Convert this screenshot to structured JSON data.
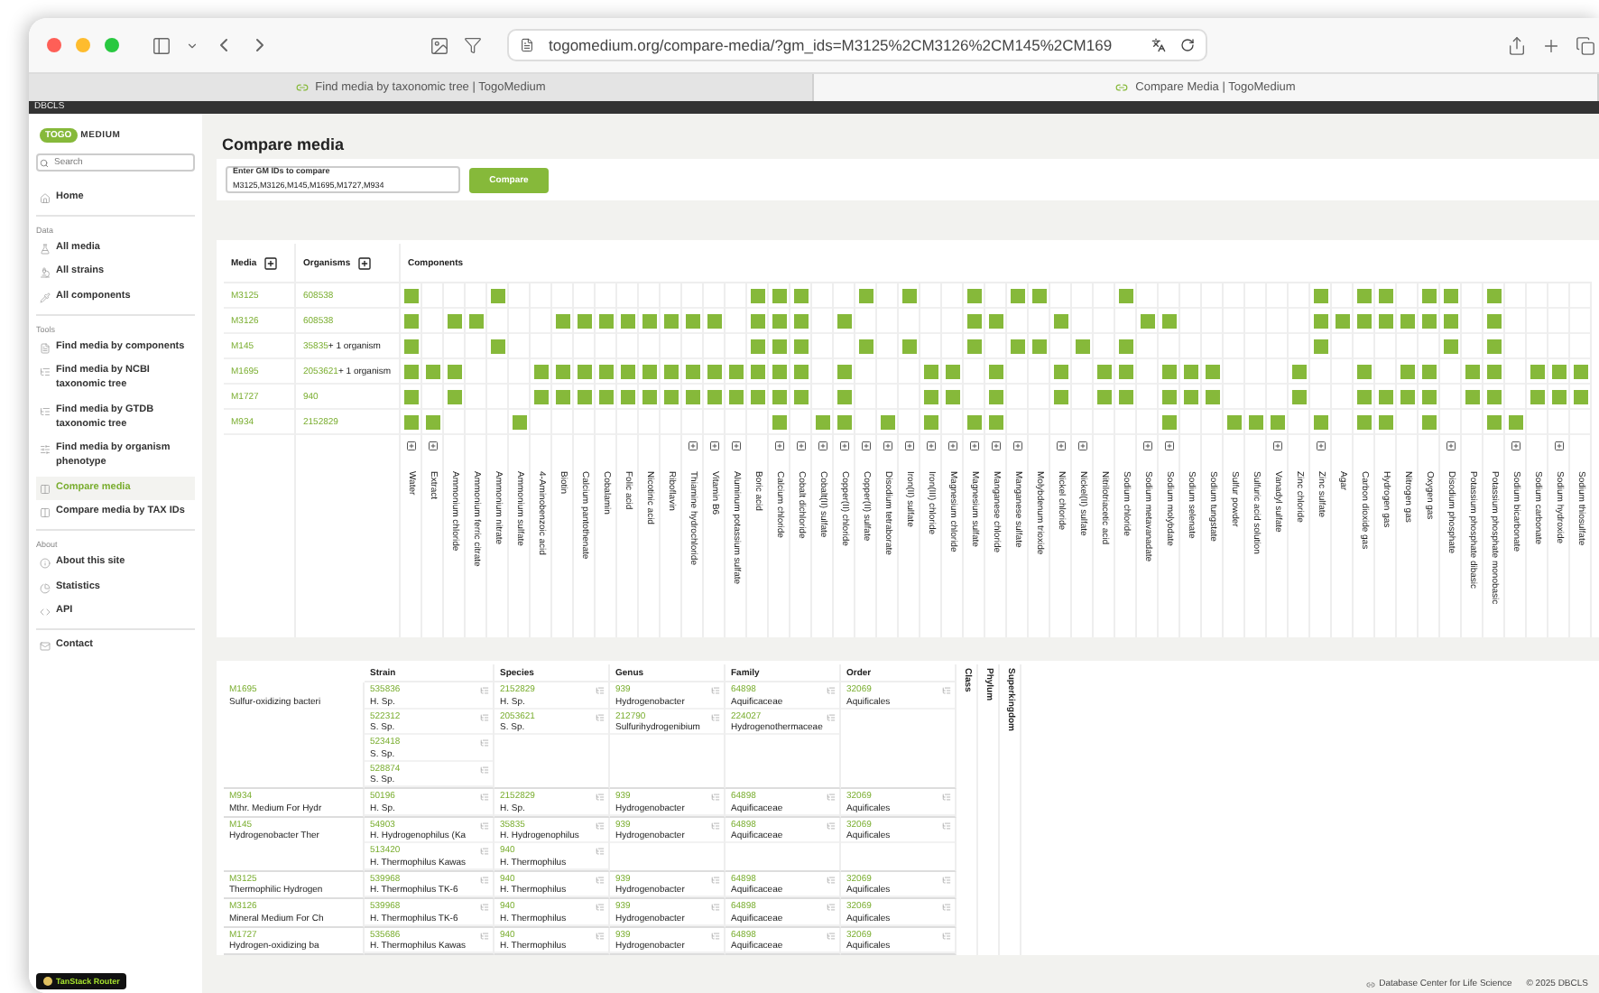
{
  "browser": {
    "url": "togomedium.org/compare-media/?gm_ids=M3125%2CM3126%2CM145%2CM169",
    "tabs": [
      {
        "label": "Find media by taxonomic tree | TogoMedium",
        "selected": false
      },
      {
        "label": "Compare Media | TogoMedium",
        "selected": true
      }
    ]
  },
  "top_strip": {
    "label": "DBCLS"
  },
  "sidebar": {
    "logo": {
      "badge": "TOGO",
      "text": "MEDIUM"
    },
    "search": {
      "placeholder": "Search"
    },
    "home": {
      "label": "Home",
      "selected": false
    },
    "sections": [
      {
        "title": "Data",
        "items": [
          {
            "label": "All media",
            "selected": false
          },
          {
            "label": "All strains",
            "selected": false
          },
          {
            "label": "All components",
            "selected": false
          }
        ]
      },
      {
        "title": "Tools",
        "items": [
          {
            "label": "Find media by components",
            "selected": false
          },
          {
            "label": "Find media by NCBI taxonomic tree",
            "selected": false
          },
          {
            "label": "Find media by GTDB taxonomic tree",
            "selected": false
          },
          {
            "label": "Find media by organism phenotype",
            "selected": false
          },
          {
            "label": "Compare media",
            "selected": true
          },
          {
            "label": "Compare media by TAX IDs",
            "selected": false
          }
        ]
      },
      {
        "title": "About",
        "items": [
          {
            "label": "About this site",
            "selected": false
          },
          {
            "label": "Statistics",
            "selected": false
          },
          {
            "label": "API",
            "selected": false
          }
        ]
      }
    ],
    "contact": {
      "label": "Contact",
      "selected": false
    },
    "devtools_badge": "TanStack Router"
  },
  "page": {
    "title": "Compare media",
    "field": {
      "label": "Enter GM IDs to compare",
      "value": "M3125,M3126,M145,M1695,M1727,M934"
    },
    "button": "Compare"
  },
  "comparison": {
    "headers": {
      "media": "Media",
      "organisms": "Organisms",
      "components": "Components"
    },
    "components": [
      {
        "name": "Water",
        "expandable": true
      },
      {
        "name": "Extract",
        "expandable": true
      },
      {
        "name": "Ammonium chloride",
        "expandable": false
      },
      {
        "name": "Ammonium ferric citrate",
        "expandable": false
      },
      {
        "name": "Ammonium nitrate",
        "expandable": false
      },
      {
        "name": "Ammonium sulfate",
        "expandable": false
      },
      {
        "name": "4-Aminobenzoic acid",
        "expandable": false
      },
      {
        "name": "Biotin",
        "expandable": false
      },
      {
        "name": "Calcium pantothenate",
        "expandable": false
      },
      {
        "name": "Cobalamin",
        "expandable": false
      },
      {
        "name": "Folic acid",
        "expandable": false
      },
      {
        "name": "Nicotinic acid",
        "expandable": false
      },
      {
        "name": "Riboflavin",
        "expandable": false
      },
      {
        "name": "Thiamine hydrochloride",
        "expandable": true
      },
      {
        "name": "Vitamin B6",
        "expandable": true
      },
      {
        "name": "Aluminum potassium sulfate",
        "expandable": true
      },
      {
        "name": "Boric acid",
        "expandable": false
      },
      {
        "name": "Calcium chloride",
        "expandable": true
      },
      {
        "name": "Cobalt dichloride",
        "expandable": true
      },
      {
        "name": "Cobalt(II) sulfate",
        "expandable": true
      },
      {
        "name": "Copper(II) chloride",
        "expandable": true
      },
      {
        "name": "Copper(II) sulfate",
        "expandable": true
      },
      {
        "name": "Disodium tetraborate",
        "expandable": true
      },
      {
        "name": "Iron(II) sulfate",
        "expandable": true
      },
      {
        "name": "Iron(III) chloride",
        "expandable": true
      },
      {
        "name": "Magnesium chloride",
        "expandable": true
      },
      {
        "name": "Magnesium sulfate",
        "expandable": true
      },
      {
        "name": "Manganese chloride",
        "expandable": true
      },
      {
        "name": "Manganese sulfate",
        "expandable": true
      },
      {
        "name": "Molybdenum trioxide",
        "expandable": false
      },
      {
        "name": "Nickel chloride",
        "expandable": true
      },
      {
        "name": "Nickel(II) sulfate",
        "expandable": true
      },
      {
        "name": "Nitrilotriacetic acid",
        "expandable": false
      },
      {
        "name": "Sodium chloride",
        "expandable": false
      },
      {
        "name": "Sodium metavanadate",
        "expandable": true
      },
      {
        "name": "Sodium molybdate",
        "expandable": true
      },
      {
        "name": "Sodium selenate",
        "expandable": false
      },
      {
        "name": "Sodium tungstate",
        "expandable": false
      },
      {
        "name": "Sulfur powder",
        "expandable": false
      },
      {
        "name": "Sulfuric acid solution",
        "expandable": false
      },
      {
        "name": "Vanadyl sulfate",
        "expandable": true
      },
      {
        "name": "Zinc chloride",
        "expandable": false
      },
      {
        "name": "Zinc sulfate",
        "expandable": true
      },
      {
        "name": "Agar",
        "expandable": false
      },
      {
        "name": "Carbon dioxide gas",
        "expandable": false
      },
      {
        "name": "Hydrogen gas",
        "expandable": false
      },
      {
        "name": "Nitrogen gas",
        "expandable": false
      },
      {
        "name": "Oxygen gas",
        "expandable": false
      },
      {
        "name": "Disodium phosphate",
        "expandable": true
      },
      {
        "name": "Potassium phosphate dibasic",
        "expandable": false
      },
      {
        "name": "Potassium phosphate monobasic",
        "expandable": false
      },
      {
        "name": "Sodium bicarbonate",
        "expandable": true
      },
      {
        "name": "Sodium carbonate",
        "expandable": false
      },
      {
        "name": "Sodium hydroxide",
        "expandable": true
      },
      {
        "name": "Sodium thiosulfate",
        "expandable": false
      }
    ],
    "media": [
      {
        "id": "M3125",
        "organism": "608538",
        "present": [
          true,
          false,
          false,
          false,
          true,
          false,
          false,
          false,
          false,
          false,
          false,
          false,
          false,
          false,
          false,
          false,
          true,
          true,
          true,
          false,
          false,
          true,
          false,
          true,
          false,
          false,
          true,
          false,
          true,
          true,
          false,
          false,
          false,
          true,
          false,
          false,
          false,
          false,
          false,
          false,
          false,
          false,
          true,
          false,
          true,
          true,
          false,
          true,
          true,
          false,
          true,
          false,
          false,
          false,
          false
        ]
      },
      {
        "id": "M3126",
        "organism": "608538",
        "present": [
          true,
          false,
          true,
          true,
          false,
          false,
          false,
          true,
          true,
          true,
          true,
          true,
          true,
          true,
          true,
          false,
          true,
          true,
          true,
          false,
          true,
          false,
          false,
          false,
          false,
          false,
          true,
          true,
          false,
          false,
          true,
          false,
          false,
          false,
          true,
          true,
          false,
          false,
          false,
          false,
          false,
          false,
          true,
          true,
          true,
          true,
          true,
          true,
          true,
          false,
          true,
          false,
          false,
          false,
          false
        ]
      },
      {
        "id": "M145",
        "organism": "35835",
        "extra": " + 1 organism",
        "present": [
          true,
          false,
          false,
          false,
          true,
          false,
          false,
          false,
          false,
          false,
          false,
          false,
          false,
          false,
          false,
          false,
          true,
          true,
          true,
          false,
          false,
          true,
          false,
          true,
          false,
          false,
          true,
          false,
          true,
          true,
          false,
          true,
          false,
          true,
          false,
          false,
          false,
          false,
          false,
          false,
          false,
          false,
          true,
          false,
          false,
          false,
          false,
          false,
          true,
          false,
          true,
          false,
          false,
          false,
          false
        ]
      },
      {
        "id": "M1695",
        "organism": "2053621",
        "extra": " + 1 organism",
        "present": [
          true,
          true,
          true,
          false,
          false,
          false,
          true,
          true,
          true,
          true,
          true,
          true,
          true,
          true,
          true,
          true,
          true,
          true,
          true,
          false,
          true,
          false,
          false,
          false,
          true,
          true,
          false,
          true,
          false,
          false,
          true,
          false,
          true,
          true,
          false,
          true,
          true,
          true,
          false,
          false,
          false,
          true,
          false,
          false,
          true,
          false,
          true,
          true,
          false,
          true,
          true,
          false,
          true,
          true,
          true
        ]
      },
      {
        "id": "M1727",
        "organism": "940",
        "present": [
          true,
          false,
          true,
          false,
          false,
          false,
          true,
          true,
          true,
          true,
          true,
          true,
          true,
          true,
          true,
          true,
          true,
          true,
          true,
          false,
          true,
          false,
          false,
          false,
          true,
          true,
          false,
          true,
          false,
          false,
          true,
          false,
          true,
          true,
          false,
          true,
          true,
          true,
          false,
          false,
          false,
          true,
          false,
          false,
          true,
          true,
          true,
          true,
          false,
          true,
          true,
          false,
          true,
          true,
          true
        ]
      },
      {
        "id": "M934",
        "organism": "2152829",
        "present": [
          true,
          true,
          false,
          false,
          false,
          true,
          false,
          false,
          false,
          false,
          false,
          false,
          false,
          false,
          false,
          false,
          false,
          true,
          false,
          true,
          true,
          false,
          true,
          false,
          true,
          false,
          true,
          true,
          false,
          false,
          false,
          false,
          false,
          false,
          false,
          true,
          false,
          false,
          true,
          true,
          true,
          false,
          true,
          false,
          true,
          true,
          false,
          true,
          false,
          false,
          true,
          true,
          false,
          false,
          false
        ]
      }
    ]
  },
  "taxonomy": {
    "columns": [
      "Strain",
      "Species",
      "Genus",
      "Family",
      "Order"
    ],
    "extra_columns": [
      "Class",
      "Phylum",
      "Superkingdom"
    ],
    "rows": [
      {
        "id": "M1695",
        "name": "Sulfur-oxidizing bacteri",
        "cells": [
          [
            {
              "id": "535836",
              "name": "H. Sp."
            },
            {
              "id": "522312",
              "name": "S. Sp."
            },
            {
              "id": "523418",
              "name": "S. Sp."
            },
            {
              "id": "528874",
              "name": "S. Sp."
            }
          ],
          [
            {
              "id": "2152829",
              "name": "H. Sp."
            },
            {
              "id": "2053621",
              "name": "S. Sp."
            }
          ],
          [
            {
              "id": "939",
              "name": "Hydrogenobacter"
            },
            {
              "id": "212790",
              "name": "Sulfurihydrogenibium"
            }
          ],
          [
            {
              "id": "64898",
              "name": "Aquificaceae"
            },
            {
              "id": "224027",
              "name": "Hydrogenothermaceae"
            }
          ],
          [
            {
              "id": "32069",
              "name": "Aquificales"
            }
          ]
        ]
      },
      {
        "id": "M934",
        "name": "Mthr. Medium For Hydr",
        "cells": [
          [
            {
              "id": "50196",
              "name": "H. Sp."
            }
          ],
          [
            {
              "id": "2152829",
              "name": "H. Sp."
            }
          ],
          [
            {
              "id": "939",
              "name": "Hydrogenobacter"
            }
          ],
          [
            {
              "id": "64898",
              "name": "Aquificaceae"
            }
          ],
          [
            {
              "id": "32069",
              "name": "Aquificales"
            }
          ]
        ]
      },
      {
        "id": "M145",
        "name": "Hydrogenobacter Ther",
        "cells": [
          [
            {
              "id": "54903",
              "name": "H. Hydrogenophilus (Ka"
            },
            {
              "id": "513420",
              "name": "H. Thermophilus Kawas"
            }
          ],
          [
            {
              "id": "35835",
              "name": "H. Hydrogenophilus"
            },
            {
              "id": "940",
              "name": "H. Thermophilus"
            }
          ],
          [
            {
              "id": "939",
              "name": "Hydrogenobacter"
            }
          ],
          [
            {
              "id": "64898",
              "name": "Aquificaceae"
            }
          ],
          [
            {
              "id": "32069",
              "name": "Aquificales"
            }
          ]
        ]
      },
      {
        "id": "M3125",
        "name": "Thermophilic Hydrogen",
        "cells": [
          [
            {
              "id": "539968",
              "name": "H. Thermophilus TK-6"
            }
          ],
          [
            {
              "id": "940",
              "name": "H. Thermophilus"
            }
          ],
          [
            {
              "id": "939",
              "name": "Hydrogenobacter"
            }
          ],
          [
            {
              "id": "64898",
              "name": "Aquificaceae"
            }
          ],
          [
            {
              "id": "32069",
              "name": "Aquificales"
            }
          ]
        ]
      },
      {
        "id": "M3126",
        "name": "Mineral Medium For Ch",
        "cells": [
          [
            {
              "id": "539968",
              "name": "H. Thermophilus TK-6"
            }
          ],
          [
            {
              "id": "940",
              "name": "H. Thermophilus"
            }
          ],
          [
            {
              "id": "939",
              "name": "Hydrogenobacter"
            }
          ],
          [
            {
              "id": "64898",
              "name": "Aquificaceae"
            }
          ],
          [
            {
              "id": "32069",
              "name": "Aquificales"
            }
          ]
        ]
      },
      {
        "id": "M1727",
        "name": "Hydrogen-oxidizing ba",
        "cells": [
          [
            {
              "id": "535686",
              "name": "H. Thermophilus Kawas"
            }
          ],
          [
            {
              "id": "940",
              "name": "H. Thermophilus"
            }
          ],
          [
            {
              "id": "939",
              "name": "Hydrogenobacter"
            }
          ],
          [
            {
              "id": "64898",
              "name": "Aquificaceae"
            }
          ],
          [
            {
              "id": "32069",
              "name": "Aquificales"
            }
          ]
        ]
      }
    ]
  },
  "footer": {
    "org": "Database Center for Life Science",
    "copyright": "© 2025 DBCLS"
  }
}
